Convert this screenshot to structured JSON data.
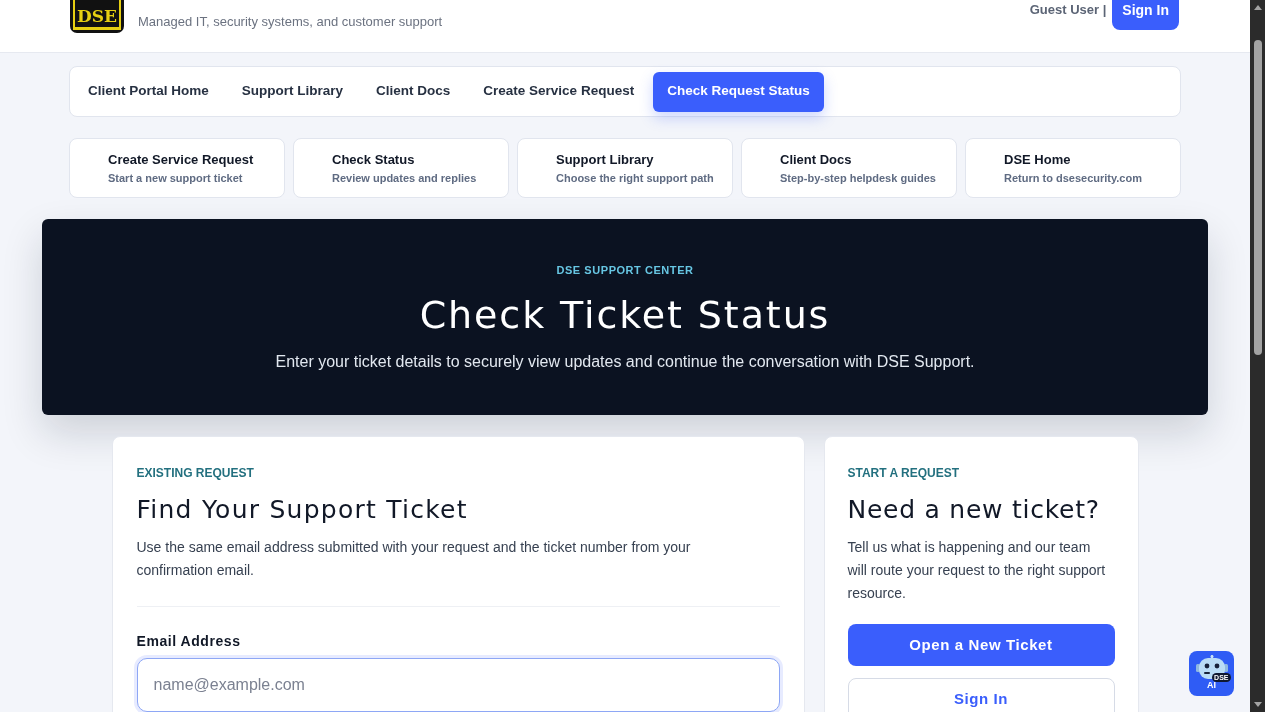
{
  "header": {
    "logo_text": "DSE",
    "tagline": "Managed IT, security systems, and customer support",
    "user_label": "Guest User |",
    "sign_in": "Sign In"
  },
  "nav": [
    {
      "label": "Client Portal Home",
      "selected": false
    },
    {
      "label": "Support Library",
      "selected": false
    },
    {
      "label": "Client Docs",
      "selected": false
    },
    {
      "label": "Create Service Request",
      "selected": false
    },
    {
      "label": "Check Request Status",
      "selected": true
    }
  ],
  "quick_links": [
    {
      "title": "Create Service Request",
      "subtitle": "Start a new support ticket"
    },
    {
      "title": "Check Status",
      "subtitle": "Review updates and replies"
    },
    {
      "title": "Support Library",
      "subtitle": "Choose the right support path"
    },
    {
      "title": "Client Docs",
      "subtitle": "Step-by-step helpdesk guides"
    },
    {
      "title": "DSE Home",
      "subtitle": "Return to dsesecurity.com"
    }
  ],
  "hero": {
    "eyebrow": "DSE SUPPORT CENTER",
    "title": "Check Ticket Status",
    "subtitle": "Enter your ticket details to securely view updates and continue the conversation with DSE Support."
  },
  "lookup_card": {
    "eyebrow": "EXISTING REQUEST",
    "title": "Find Your Support Ticket",
    "description": "Use the same email address submitted with your request and the ticket number from your confirmation email.",
    "fields": [
      {
        "label": "Email Address",
        "placeholder": "name@example.com",
        "focused": true
      }
    ]
  },
  "new_ticket_card": {
    "eyebrow": "START A REQUEST",
    "title": "Need a new ticket?",
    "description": "Tell us what is happening and our team will route your request to the right support resource.",
    "buttons": [
      {
        "label": "Open a New Ticket",
        "kind": "primary"
      },
      {
        "label": "Sign In",
        "kind": "secondary"
      }
    ]
  },
  "chat_widget": {
    "badge": "DSE",
    "label": "AI"
  }
}
